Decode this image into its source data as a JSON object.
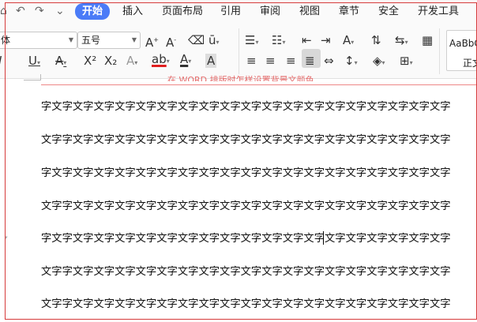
{
  "menu": {
    "quick_access": [
      "↶",
      "↷",
      "⌄"
    ],
    "tabs": [
      {
        "label": "开始",
        "active": true
      },
      {
        "label": "插入",
        "active": false
      },
      {
        "label": "页面布局",
        "active": false
      },
      {
        "label": "引用",
        "active": false
      },
      {
        "label": "审阅",
        "active": false
      },
      {
        "label": "视图",
        "active": false
      },
      {
        "label": "章节",
        "active": false
      },
      {
        "label": "安全",
        "active": false
      },
      {
        "label": "开发工具",
        "active": false
      }
    ]
  },
  "ribbon": {
    "font_name": "体",
    "font_size": "五号",
    "style_preview": "AaBbC",
    "style_name": "正文"
  },
  "document": {
    "partial_title": "在 WORD 排版时怎样设置背景文颜色",
    "lines": [
      "字文字文字文字文字文字文字文字文字文字文字文字文字文字文字文字文字文字文字文字",
      "文字字文字文字文字文字文字文字文字文字文字文字文字文字文字文字文字文字文字文字",
      "字文字文字文字文字文字文字文字文字文字文字文字文字文字文字文字文字文字文字文字",
      "文字字文字文字文字文字文字文字文字文字文字文字文字文字文字文字文字文字文字文字",
      "字文字文字文字文字文字文字文字文字文字文字文字文字文字文字文字文字文字文字文字",
      "文字字文字文字文字文字文字文字文字文字文字文字文字文字文字文字文字文字文字文字",
      "文字字文字文字文字文字文字文字文字文字文字文字文字文字文字文字文字文字文字文字"
    ]
  },
  "colors": {
    "accent": "#4a7bf7",
    "frame": "#d63b3b",
    "highlight_bar": "#e02020"
  }
}
